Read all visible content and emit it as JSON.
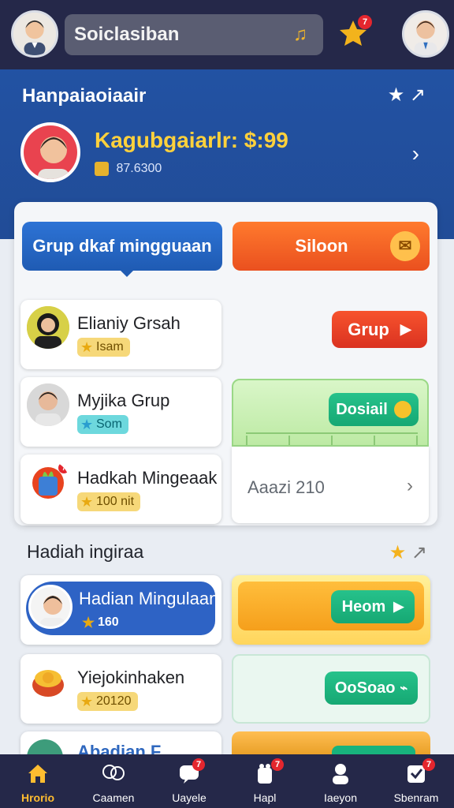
{
  "top_bar": {
    "search_text": "Soiclasiban",
    "star_badge": "7"
  },
  "hero": {
    "title": "Hanpaiaoiaair",
    "name_price": "Kagubgaiarlr: $:99",
    "coins": "87.6300"
  },
  "main": {
    "left_pill": "Grup dkaf mingguaan",
    "right_pill": "Siloon",
    "cards": [
      {
        "title": "Elianiy Grsah",
        "tag": "Isam"
      },
      {
        "title": "Myjika Grup",
        "tag": "Som"
      },
      {
        "title": "Hadkah Mingeaak",
        "tag": "100 nit"
      }
    ],
    "action_button": "Grup",
    "detail_button": "Dosiail",
    "panel_text": "Aaazi 210"
  },
  "section": {
    "title": "Hadiah ingiraa",
    "items": [
      {
        "title": "Hadian Mingulaan",
        "tag": "160"
      },
      {
        "title": "Yiejokinhaken",
        "tag": "20120"
      },
      {
        "title": "Abadian F Garaon",
        "tag": ""
      }
    ],
    "yellow_button": "Heom",
    "mint_button": "OoSoao"
  },
  "nav": [
    {
      "label": "Hrorio"
    },
    {
      "label": "Caamen"
    },
    {
      "label": "Uayele"
    },
    {
      "label": "Hapl"
    },
    {
      "label": "Iaeyon"
    },
    {
      "label": "Sbenram"
    }
  ],
  "colors": {
    "navy": "#252849",
    "hero_blue": "#214c97",
    "gold": "#ffd13c",
    "orange": "#ea501f",
    "green": "#16a873"
  }
}
